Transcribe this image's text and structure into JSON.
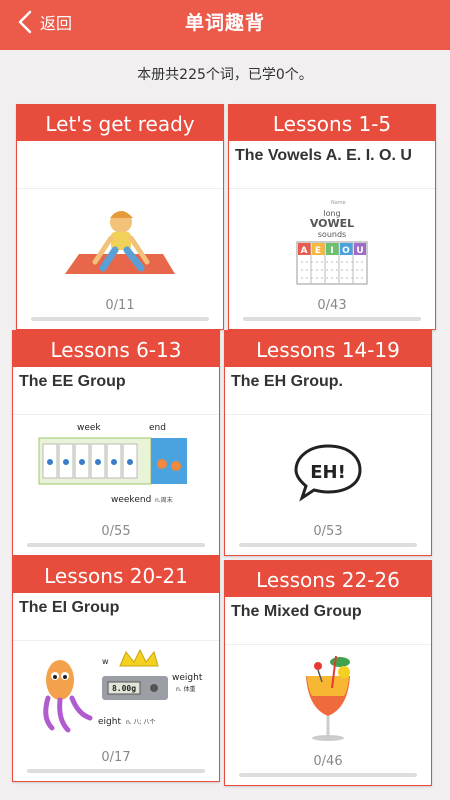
{
  "header": {
    "back_label": "返回",
    "title": "单词趣背"
  },
  "summary": "本册共225个词，已学0个。",
  "cards": [
    {
      "title": "Let's get ready",
      "subtitle": "",
      "count": "0/11",
      "progress": 0,
      "art": "kid-starting-position"
    },
    {
      "title": "Lessons 1-5",
      "subtitle": "The Vowels A. E. I. O. U",
      "count": "0/43",
      "progress": 0,
      "art": "long-vowel-sounds-chart",
      "art_text": {
        "small": "Name",
        "line1": "long",
        "line2": "VOWEL",
        "line3": "sounds",
        "letters": [
          "A",
          "E",
          "I",
          "O",
          "U"
        ]
      }
    },
    {
      "title": "Lessons 6-13",
      "subtitle": "The EE Group",
      "count": "0/55",
      "progress": 0,
      "art": "weekend-calendar",
      "art_text": {
        "week": "week",
        "end": "end",
        "word": "weekend",
        "meaning": "n.周末"
      }
    },
    {
      "title": "Lessons 14-19",
      "subtitle": "The EH Group.",
      "count": "0/53",
      "progress": 0,
      "art": "speech-bubble-eh",
      "art_text": {
        "bubble": "EH!"
      }
    },
    {
      "title": "Lessons 20-21",
      "subtitle": "The EI Group",
      "count": "0/17",
      "progress": 0,
      "art": "octopus-scale-crown",
      "art_text": {
        "w": "w",
        "weight": "weight",
        "weight_meaning": "n. 体重",
        "scale": "8.00g",
        "eight": "eight",
        "eight_meaning": "n. 八; 八个"
      }
    },
    {
      "title": "Lessons 22-26",
      "subtitle": "The Mixed Group",
      "count": "0/46",
      "progress": 0,
      "art": "cocktail-glass"
    }
  ],
  "colors": {
    "accent": "#e74c3c",
    "header": "#ec5a4a",
    "background": "#f1efef"
  }
}
